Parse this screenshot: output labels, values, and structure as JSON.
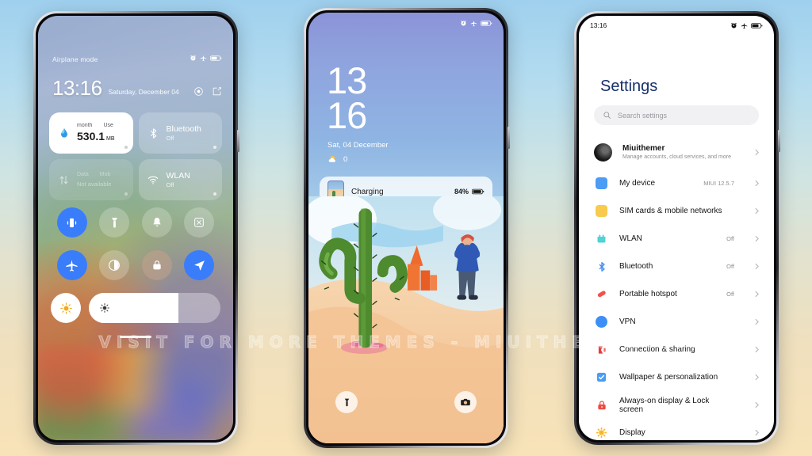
{
  "watermark": "VISIT FOR MORE THEMES - MIUITHEMER.COM",
  "phone1": {
    "name": "control-center",
    "status": {
      "label": "Airplane mode",
      "icons": [
        "alarm-icon",
        "airplane-icon",
        "battery-icon"
      ]
    },
    "clock": {
      "time": "13:16",
      "date": "Saturday, December 04"
    },
    "header_icons": [
      "settings-gear-icon",
      "edit-icon"
    ],
    "tiles": [
      {
        "icon": "data-usage-icon",
        "sub_left": "month",
        "sub_right": "Use",
        "value": "530.1",
        "unit": "MB",
        "style": "white"
      },
      {
        "icon": "bluetooth-icon",
        "title": "Bluetooth",
        "state": "Off",
        "style": "glass"
      },
      {
        "icon": "mobile-data-icon",
        "sub_left": "Data",
        "sub_right": "Mob",
        "value": "Not available",
        "style": "glass-dim"
      },
      {
        "icon": "wlan-icon",
        "title": "WLAN",
        "state": "Off",
        "style": "glass"
      }
    ],
    "toggles": [
      {
        "icon": "vibrate-icon",
        "state": "on"
      },
      {
        "icon": "flashlight-icon",
        "state": "off"
      },
      {
        "icon": "bell-icon",
        "state": "off"
      },
      {
        "icon": "screenshot-icon",
        "state": "off"
      },
      {
        "icon": "airplane-icon",
        "state": "on"
      },
      {
        "icon": "dark-mode-icon",
        "state": "off"
      },
      {
        "icon": "lock-icon",
        "state": "warm"
      },
      {
        "icon": "location-icon",
        "state": "on"
      }
    ],
    "brightness": {
      "auto_icon": "auto-brightness-icon",
      "slider_icon": "brightness-icon",
      "level": 68
    }
  },
  "phone2": {
    "name": "lock-screen",
    "status": {
      "icons": [
        "alarm-icon",
        "airplane-icon",
        "battery-icon"
      ]
    },
    "time_hour": "13",
    "time_minute": "16",
    "date": "Sat, 04 December",
    "weather": {
      "icon": "sun-cloud-icon",
      "temp": "0"
    },
    "notification": {
      "app_icon": "wallpaper-app-icon",
      "title": "Charging",
      "battery_percent": "84%",
      "battery_icon": "battery-icon"
    },
    "shortcuts": [
      {
        "icon": "flashlight-icon",
        "position": "left"
      },
      {
        "icon": "camera-icon",
        "position": "right"
      }
    ]
  },
  "phone3": {
    "name": "settings-app",
    "status": {
      "time": "13:16",
      "icons": [
        "alarm-icon",
        "airplane-icon",
        "battery-icon"
      ]
    },
    "title": "Settings",
    "search_placeholder": "Search settings",
    "account": {
      "avatar": "user-avatar",
      "name": "Miuithemer",
      "subtitle": "Manage accounts, cloud services, and more"
    },
    "items": [
      {
        "icon": "my-device-icon",
        "color": "#4a9cf5",
        "label": "My device",
        "value": "MIUI 12.5.7"
      },
      {
        "icon": "sim-cards-icon",
        "color": "#f8ca4d",
        "label": "SIM cards & mobile networks",
        "value": ""
      },
      {
        "icon": "wlan-icon",
        "color": "#4ed3d9",
        "label": "WLAN",
        "value": "Off"
      },
      {
        "icon": "bluetooth-icon",
        "color": "#3d8ff5",
        "label": "Bluetooth",
        "value": "Off"
      },
      {
        "icon": "portable-hotspot-icon",
        "color": "#f2524c",
        "label": "Portable hotspot",
        "value": "Off"
      },
      {
        "icon": "vpn-icon",
        "color": "#3d8ff5",
        "label": "VPN",
        "value": ""
      },
      {
        "icon": "connection-sharing-icon",
        "color": "#e33d3d",
        "label": "Connection & sharing",
        "value": ""
      },
      {
        "icon": "wallpaper-personalization-icon",
        "color": "#4a9cf5",
        "label": "Wallpaper & personalization",
        "value": ""
      },
      {
        "icon": "always-on-display-icon",
        "color": "#ef4a42",
        "label": "Always-on display & Lock screen",
        "value": ""
      },
      {
        "icon": "display-icon",
        "color": "#f9b629",
        "label": "Display",
        "value": ""
      }
    ]
  }
}
